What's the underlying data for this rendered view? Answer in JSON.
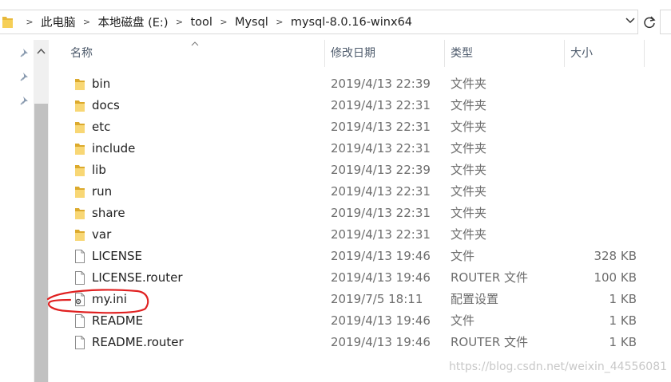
{
  "address_bar": {
    "breadcrumbs": [
      "此电脑",
      "本地磁盘 (E:)",
      "tool",
      "Mysql",
      "mysql-8.0.16-winx64"
    ],
    "dropdown_icon": "chevron-down-icon",
    "refresh_icon": "refresh-icon"
  },
  "columns": {
    "name": "名称",
    "date": "修改日期",
    "type": "类型",
    "size": "大小",
    "sorted_by": "name"
  },
  "files": [
    {
      "name": "bin",
      "date": "2019/4/13 22:39",
      "type": "文件夹",
      "size": "",
      "kind": "folder"
    },
    {
      "name": "docs",
      "date": "2019/4/13 22:31",
      "type": "文件夹",
      "size": "",
      "kind": "folder"
    },
    {
      "name": "etc",
      "date": "2019/4/13 22:31",
      "type": "文件夹",
      "size": "",
      "kind": "folder"
    },
    {
      "name": "include",
      "date": "2019/4/13 22:31",
      "type": "文件夹",
      "size": "",
      "kind": "folder"
    },
    {
      "name": "lib",
      "date": "2019/4/13 22:39",
      "type": "文件夹",
      "size": "",
      "kind": "folder"
    },
    {
      "name": "run",
      "date": "2019/4/13 22:31",
      "type": "文件夹",
      "size": "",
      "kind": "folder"
    },
    {
      "name": "share",
      "date": "2019/4/13 22:31",
      "type": "文件夹",
      "size": "",
      "kind": "folder"
    },
    {
      "name": "var",
      "date": "2019/4/13 22:31",
      "type": "文件夹",
      "size": "",
      "kind": "folder"
    },
    {
      "name": "LICENSE",
      "date": "2019/4/13 19:46",
      "type": "文件",
      "size": "328 KB",
      "kind": "file"
    },
    {
      "name": "LICENSE.router",
      "date": "2019/4/13 19:46",
      "type": "ROUTER 文件",
      "size": "100 KB",
      "kind": "file"
    },
    {
      "name": "my.ini",
      "date": "2019/7/5 18:11",
      "type": "配置设置",
      "size": "1 KB",
      "kind": "ini"
    },
    {
      "name": "README",
      "date": "2019/4/13 19:46",
      "type": "文件",
      "size": "1 KB",
      "kind": "file"
    },
    {
      "name": "README.router",
      "date": "2019/4/13 19:46",
      "type": "ROUTER 文件",
      "size": "1 KB",
      "kind": "file"
    }
  ],
  "annotation_color": "#e02020",
  "watermark": "https://blog.csdn.net/weixin_44556081"
}
